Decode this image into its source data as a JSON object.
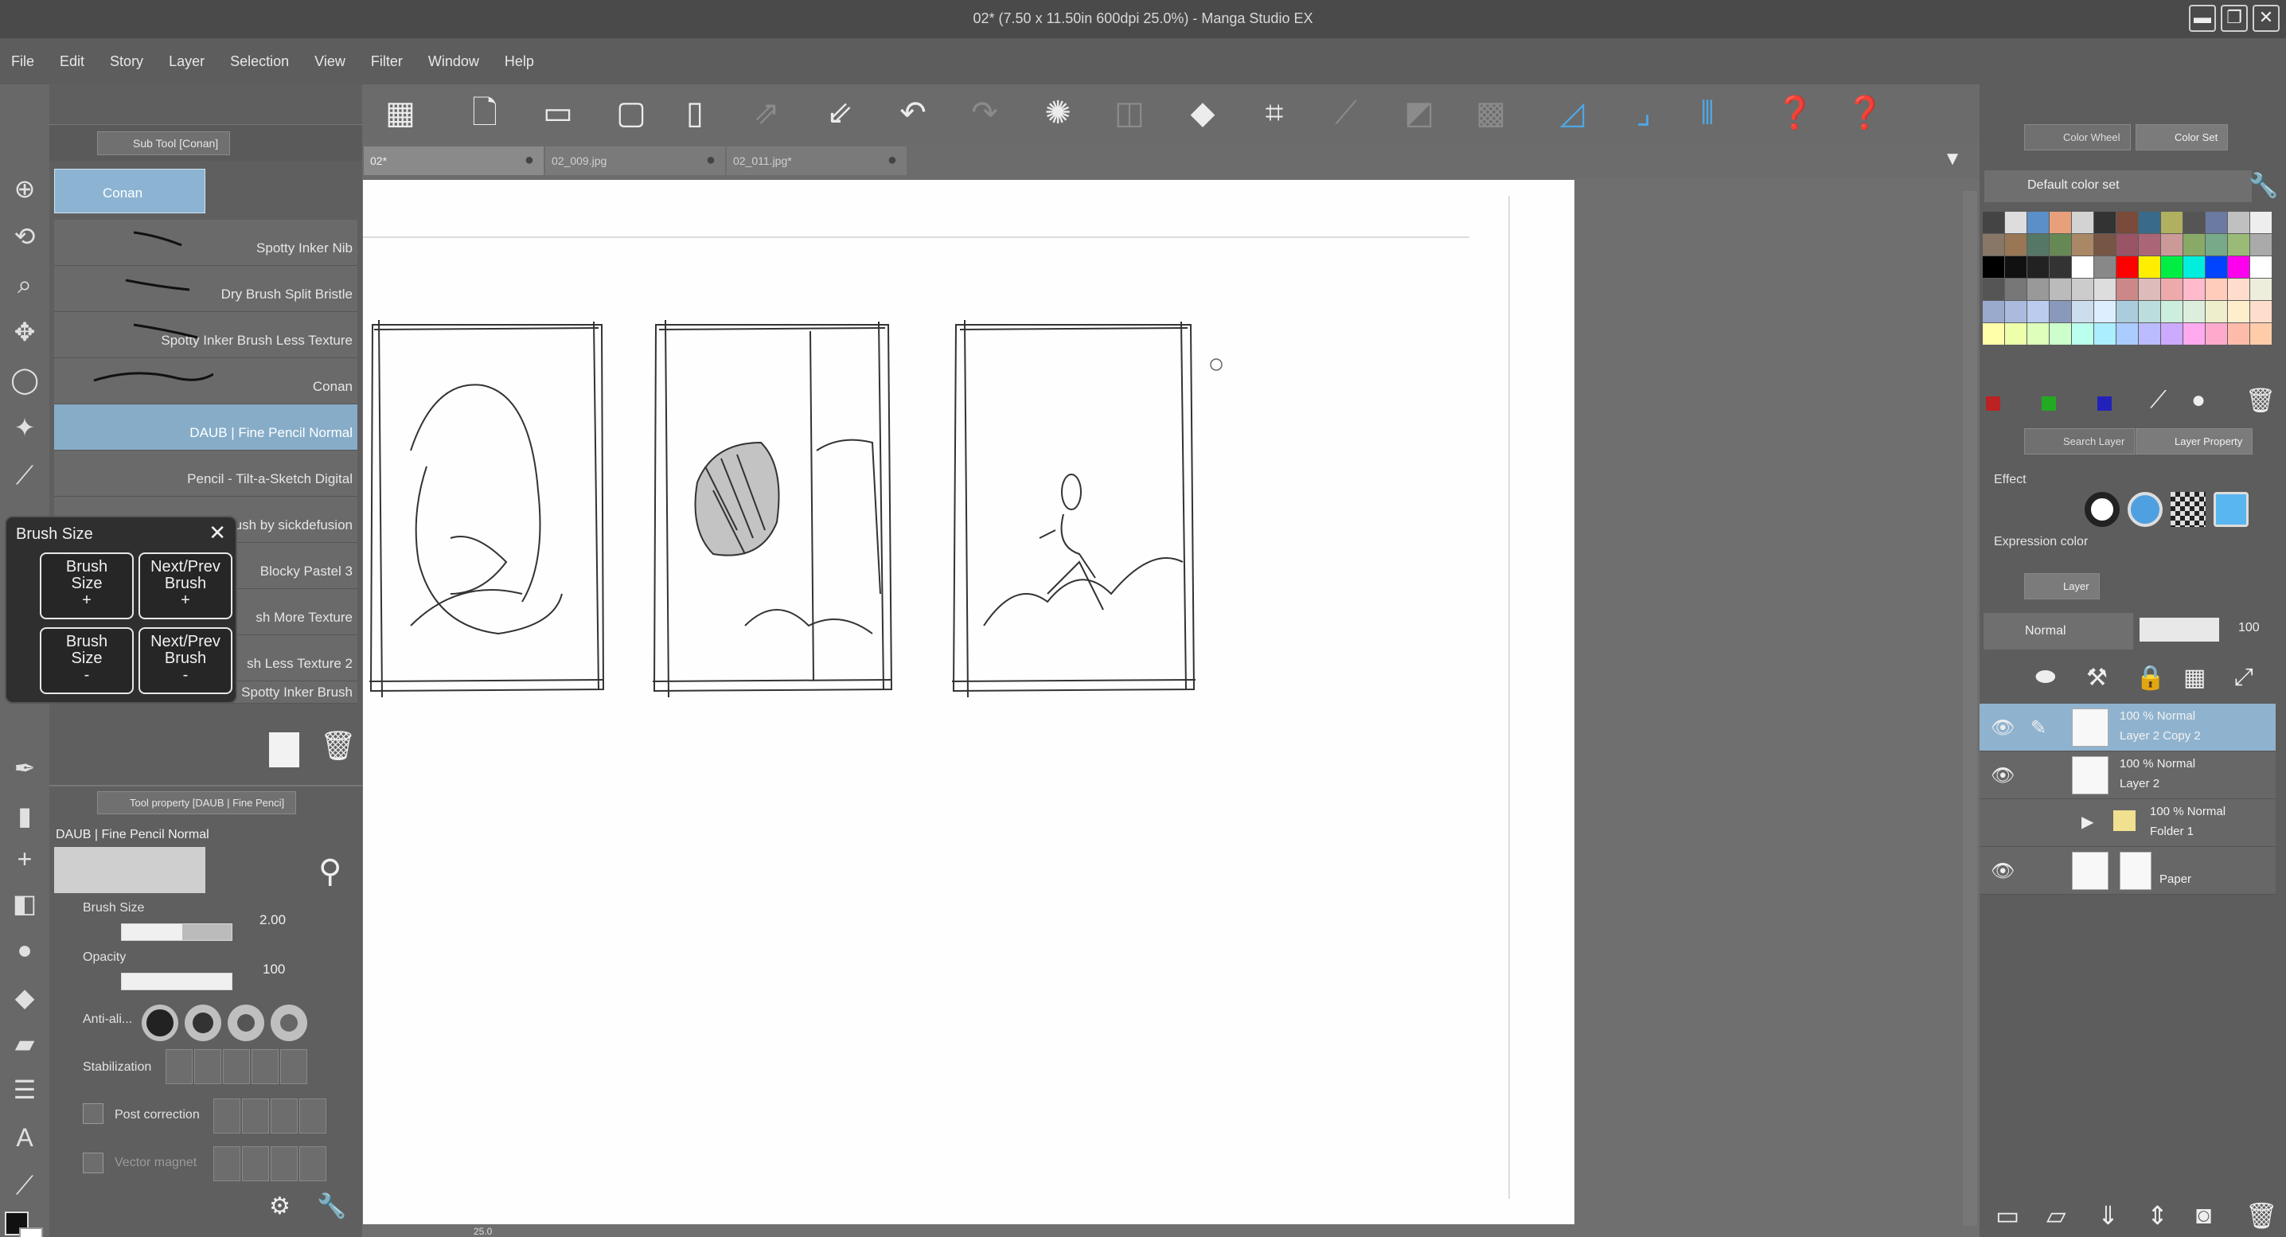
{
  "window": {
    "title": "02* (7.50 x 11.50in 600dpi 25.0%) - Manga Studio EX",
    "buttons": [
      "▬",
      "❐",
      "✕"
    ]
  },
  "menu": [
    "File",
    "Edit",
    "Story",
    "Layer",
    "Selection",
    "View",
    "Filter",
    "Window",
    "Help"
  ],
  "subtool": {
    "tab_label": "Sub Tool [Conan]",
    "group_label": "Conan",
    "brushes": [
      "Spotty Inker Nib",
      "Dry Brush Split Bristle",
      "Spotty Inker Brush Less Texture",
      "Conan",
      "DAUB | Fine Pencil Normal",
      "Pencil - Tilt-a-Sketch Digital",
      "Brush by sickdefusion",
      "Blocky Pastel 3",
      "sh More Texture",
      "sh Less Texture 2",
      "Spotty Inker Brush"
    ],
    "selected_index": 4
  },
  "brush_size_palette": {
    "title": "Brush Size",
    "buttons": [
      {
        "line1": "Brush",
        "line2": "Size",
        "line3": "+"
      },
      {
        "line1": "Next/Prev",
        "line2": "Brush",
        "line3": "+"
      },
      {
        "line1": "Brush",
        "line2": "Size",
        "line3": "-"
      },
      {
        "line1": "Next/Prev",
        "line2": "Brush",
        "line3": "-"
      }
    ]
  },
  "tool_property": {
    "tab_label": "Tool property [DAUB | Fine Penci]",
    "tool_name": "DAUB | Fine Pencil Normal",
    "brush_size_label": "Brush Size",
    "brush_size_value": "2.00",
    "brush_size_level": 0.55,
    "opacity_label": "Opacity",
    "opacity_value": "100",
    "opacity_level": 1.0,
    "anti_alias_label": "Anti-ali...",
    "stabilization_label": "Stabilization",
    "post_correction_label": "Post correction",
    "vector_magnet_label": "Vector magnet"
  },
  "doc_tabs": [
    {
      "label": "02*",
      "active": true
    },
    {
      "label": "02_009.jpg",
      "active": false
    },
    {
      "label": "02_011.jpg*",
      "active": false
    }
  ],
  "canvas_status": "25.0",
  "right_panels": {
    "color_tabs": [
      "Color Wheel",
      "Color Set"
    ],
    "color_set_name": "Default color set",
    "property_tabs": [
      "Search Layer",
      "Layer Property"
    ],
    "effect_label": "Effect",
    "expression_color_label": "Expression color",
    "layer_tabs": [
      "Layer"
    ],
    "blend_mode": "Normal",
    "opacity": "100",
    "layers": [
      {
        "meta": "100 %  Normal",
        "name": "Layer 2 Copy 2",
        "selected": true,
        "visible": true
      },
      {
        "meta": "100 %  Normal",
        "name": "Layer 2",
        "selected": false,
        "visible": true
      },
      {
        "meta": "100 %  Normal",
        "name": "Folder 1",
        "selected": false,
        "visible": false
      },
      {
        "meta": "",
        "name": "Paper",
        "selected": false,
        "visible": true
      }
    ]
  },
  "colors": {
    "accent": "#8fb3cf",
    "panel": "#5f5f5f",
    "paper": "#fefefe"
  }
}
